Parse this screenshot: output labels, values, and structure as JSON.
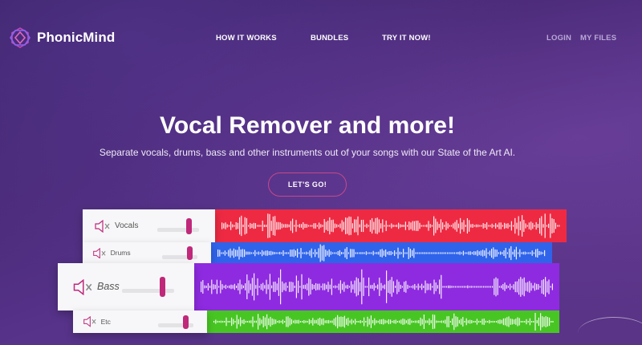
{
  "header": {
    "brand": "PhonicMind",
    "nav": [
      "HOW IT WORKS",
      "BUNDLES",
      "TRY IT NOW!"
    ],
    "login": "LOGIN",
    "my_files": "MY FILES"
  },
  "hero": {
    "title": "Vocal Remover and more!",
    "subtitle": "Separate vocals, drums, bass and other instruments out of your songs with our State of the Art AI.",
    "cta": "LET'S GO!"
  },
  "tracks": [
    {
      "label": "Vocals",
      "color": "#ee2a43",
      "volume": 0.7
    },
    {
      "label": "Drums",
      "color": "#2f63ea",
      "volume": 0.7
    },
    {
      "label": "Bass",
      "color": "#8e2be0",
      "volume": 0.72
    },
    {
      "label": "Etc",
      "color": "#47c623",
      "volume": 0.7
    }
  ],
  "colors": {
    "accent": "#c0287a",
    "background": "#4a2a78"
  },
  "icons": [
    "phonicmind-logo-icon",
    "speaker-muted-icon"
  ]
}
